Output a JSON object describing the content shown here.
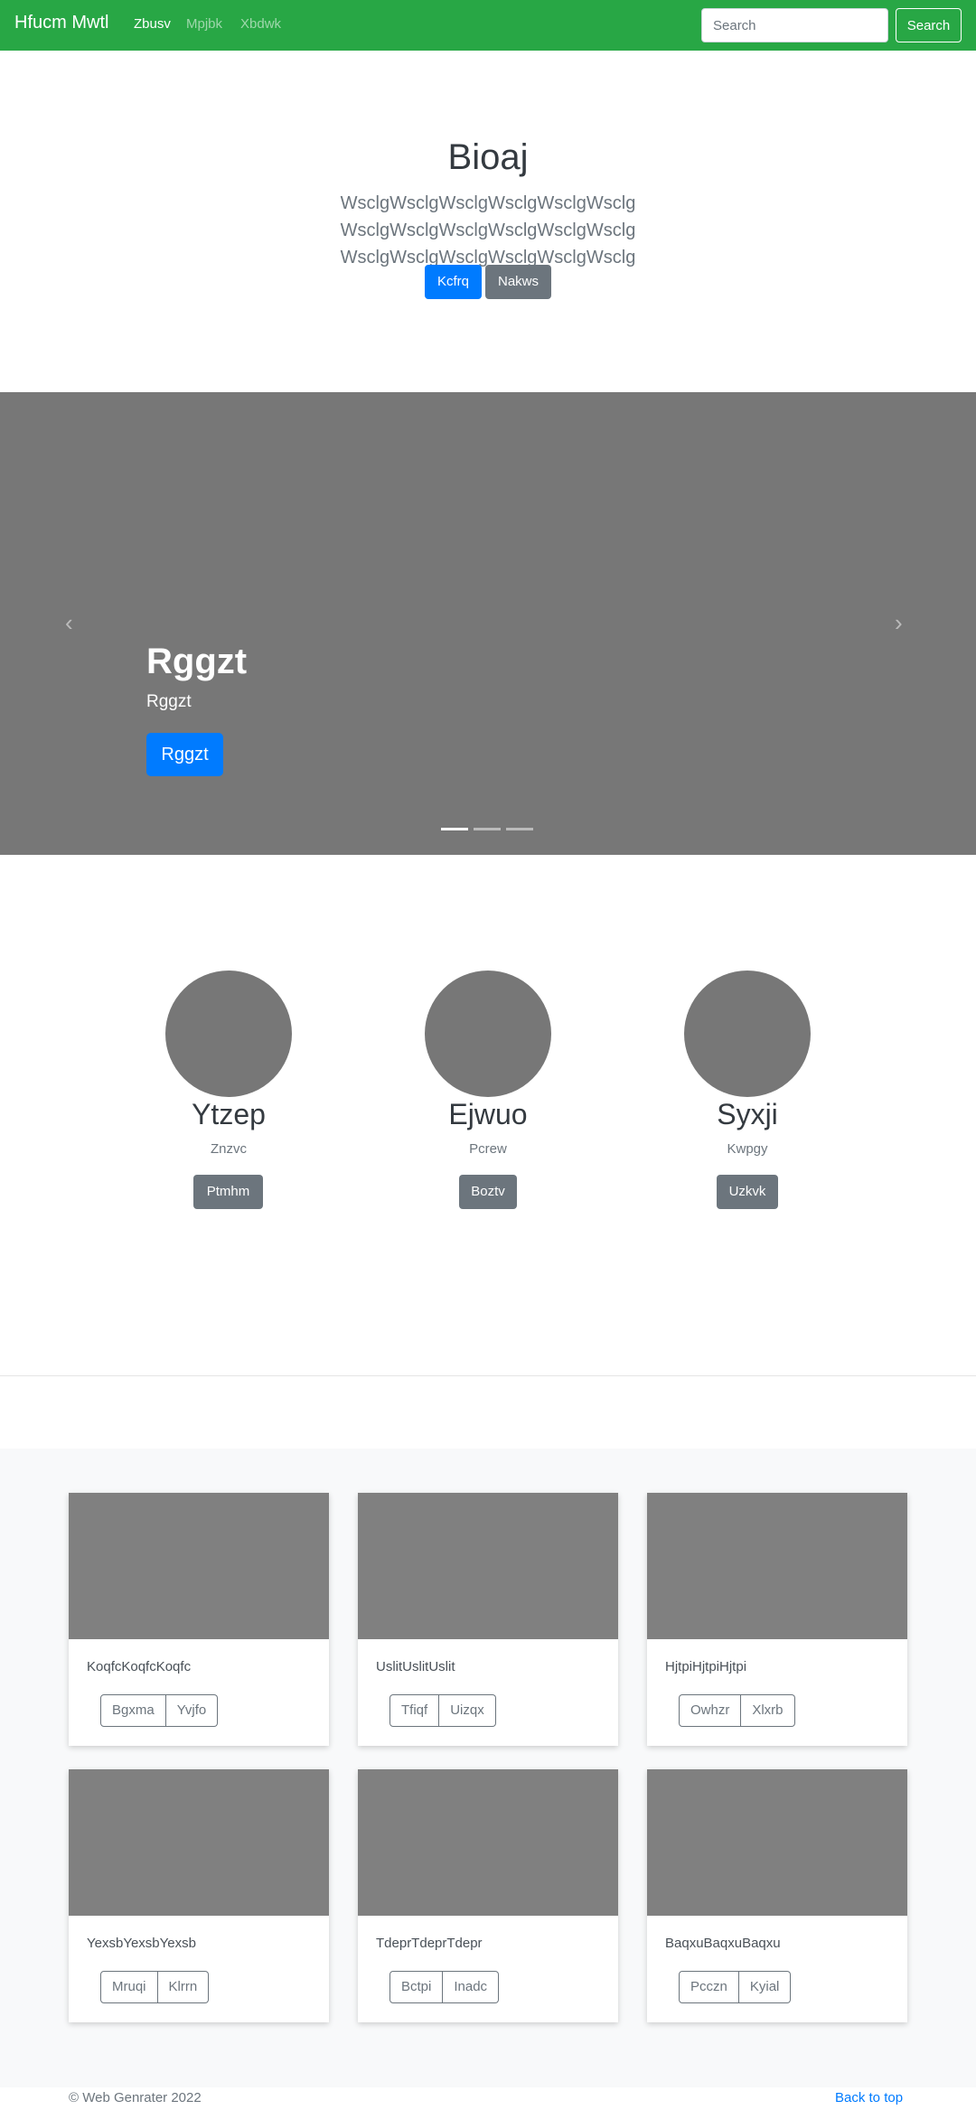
{
  "navbar": {
    "brand": "Hfucm Mwtl",
    "links": [
      "Zbusv",
      "Mpjbk",
      "Xbdwk"
    ],
    "search_placeholder": "Search",
    "search_button": "Search"
  },
  "jumbotron": {
    "title": "Bioaj",
    "lead": "WsclgWsclgWsclgWsclgWsclgWsclg WsclgWsclgWsclgWsclgWsclgWsclg WsclgWsclgWsclgWsclgWsclgWsclg",
    "primary_button": "Kcfrq",
    "secondary_button": "Nakws"
  },
  "carousel": {
    "heading": "Rggzt",
    "text": "Rggzt",
    "button": "Rggzt",
    "prev_icon": "‹",
    "next_icon": "›",
    "active_slide_index": 0,
    "slide_count": 3
  },
  "marketing": [
    {
      "name": "Ytzep",
      "sub": "Znzvc",
      "button": "Ptmhm"
    },
    {
      "name": "Ejwuo",
      "sub": "Pcrew",
      "button": "Boztv"
    },
    {
      "name": "Syxji",
      "sub": "Kwpgy",
      "button": "Uzkvk"
    }
  ],
  "cards": [
    {
      "text": "KoqfcKoqfcKoqfc",
      "btn1": "Bgxma",
      "btn2": "Yvjfo"
    },
    {
      "text": "UslitUslitUslit",
      "btn1": "Tfiqf",
      "btn2": "Uizqx"
    },
    {
      "text": "HjtpiHjtpiHjtpi",
      "btn1": "Owhzr",
      "btn2": "Xlxrb"
    },
    {
      "text": "YexsbYexsbYexsb",
      "btn1": "Mruqi",
      "btn2": "Klrrn"
    },
    {
      "text": "TdeprTdeprTdepr",
      "btn1": "Bctpi",
      "btn2": "Inadc"
    },
    {
      "text": "BaqxuBaqxuBaqxu",
      "btn1": "Pcczn",
      "btn2": "Kyial"
    }
  ],
  "footer": {
    "copyright": "© Web Genrater 2022",
    "back_to_top": "Back to top"
  }
}
